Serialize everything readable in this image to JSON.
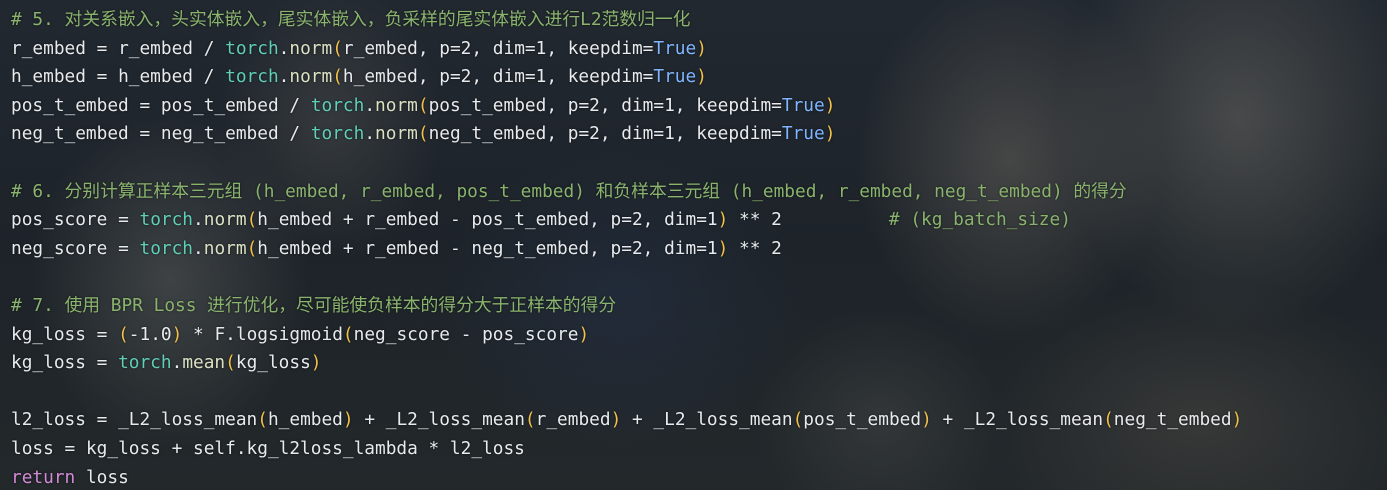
{
  "editor": {
    "language": "python",
    "theme_colors": {
      "comment": "#8ab46e",
      "module": "#5fcfb8",
      "paren": "#f2c14a",
      "keyword": "#d28bd6",
      "constant": "#7fb6ff",
      "text": "#e8ebee"
    },
    "lines": [
      [
        {
          "t": "comment",
          "v": "# 5. 对关系嵌入，头实体嵌入，尾实体嵌入，负采样的尾实体嵌入进行L2范数归一化"
        }
      ],
      [
        {
          "t": "ident",
          "v": "r_embed"
        },
        {
          "t": "op",
          "v": " = "
        },
        {
          "t": "ident",
          "v": "r_embed"
        },
        {
          "t": "op",
          "v": " / "
        },
        {
          "t": "module",
          "v": "torch"
        },
        {
          "t": "op",
          "v": "."
        },
        {
          "t": "func",
          "v": "norm"
        },
        {
          "t": "paren",
          "v": "("
        },
        {
          "t": "ident",
          "v": "r_embed, p=2, dim=1, keepdim="
        },
        {
          "t": "const",
          "v": "True"
        },
        {
          "t": "paren",
          "v": ")"
        }
      ],
      [
        {
          "t": "ident",
          "v": "h_embed"
        },
        {
          "t": "op",
          "v": " = "
        },
        {
          "t": "ident",
          "v": "h_embed"
        },
        {
          "t": "op",
          "v": " / "
        },
        {
          "t": "module",
          "v": "torch"
        },
        {
          "t": "op",
          "v": "."
        },
        {
          "t": "func",
          "v": "norm"
        },
        {
          "t": "paren",
          "v": "("
        },
        {
          "t": "ident",
          "v": "h_embed, p=2, dim=1, keepdim="
        },
        {
          "t": "const",
          "v": "True"
        },
        {
          "t": "paren",
          "v": ")"
        }
      ],
      [
        {
          "t": "ident",
          "v": "pos_t_embed"
        },
        {
          "t": "op",
          "v": " = "
        },
        {
          "t": "ident",
          "v": "pos_t_embed"
        },
        {
          "t": "op",
          "v": " / "
        },
        {
          "t": "module",
          "v": "torch"
        },
        {
          "t": "op",
          "v": "."
        },
        {
          "t": "func",
          "v": "norm"
        },
        {
          "t": "paren",
          "v": "("
        },
        {
          "t": "ident",
          "v": "pos_t_embed, p=2, dim=1, keepdim="
        },
        {
          "t": "const",
          "v": "True"
        },
        {
          "t": "paren",
          "v": ")"
        }
      ],
      [
        {
          "t": "ident",
          "v": "neg_t_embed"
        },
        {
          "t": "op",
          "v": " = "
        },
        {
          "t": "ident",
          "v": "neg_t_embed"
        },
        {
          "t": "op",
          "v": " / "
        },
        {
          "t": "module",
          "v": "torch"
        },
        {
          "t": "op",
          "v": "."
        },
        {
          "t": "func",
          "v": "norm"
        },
        {
          "t": "paren",
          "v": "("
        },
        {
          "t": "ident",
          "v": "neg_t_embed, p=2, dim=1, keepdim="
        },
        {
          "t": "const",
          "v": "True"
        },
        {
          "t": "paren",
          "v": ")"
        }
      ],
      [],
      [
        {
          "t": "comment",
          "v": "# 6. 分别计算正样本三元组 (h_embed, r_embed, pos_t_embed) 和负样本三元组 (h_embed, r_embed, neg_t_embed) 的得分"
        }
      ],
      [
        {
          "t": "ident",
          "v": "pos_score"
        },
        {
          "t": "op",
          "v": " = "
        },
        {
          "t": "module",
          "v": "torch"
        },
        {
          "t": "op",
          "v": "."
        },
        {
          "t": "func",
          "v": "norm"
        },
        {
          "t": "paren",
          "v": "("
        },
        {
          "t": "ident",
          "v": "h_embed + r_embed - pos_t_embed, p=2, dim=1"
        },
        {
          "t": "paren",
          "v": ")"
        },
        {
          "t": "op",
          "v": " ** 2          "
        },
        {
          "t": "comment",
          "v": "# (kg_batch_size)"
        }
      ],
      [
        {
          "t": "ident",
          "v": "neg_score"
        },
        {
          "t": "op",
          "v": " = "
        },
        {
          "t": "module",
          "v": "torch"
        },
        {
          "t": "op",
          "v": "."
        },
        {
          "t": "func",
          "v": "norm"
        },
        {
          "t": "paren",
          "v": "("
        },
        {
          "t": "ident",
          "v": "h_embed + r_embed - neg_t_embed, p=2, dim=1"
        },
        {
          "t": "paren",
          "v": ")"
        },
        {
          "t": "op",
          "v": " ** 2"
        }
      ],
      [],
      [
        {
          "t": "comment",
          "v": "# 7. 使用 BPR Loss 进行优化，尽可能使负样本的得分大于正样本的得分"
        }
      ],
      [
        {
          "t": "ident",
          "v": "kg_loss"
        },
        {
          "t": "op",
          "v": " = "
        },
        {
          "t": "paren",
          "v": "("
        },
        {
          "t": "ident",
          "v": "-1.0"
        },
        {
          "t": "paren",
          "v": ")"
        },
        {
          "t": "op",
          "v": " * "
        },
        {
          "t": "ident",
          "v": "F.logsigmoid"
        },
        {
          "t": "paren",
          "v": "("
        },
        {
          "t": "ident",
          "v": "neg_score - pos_score"
        },
        {
          "t": "paren",
          "v": ")"
        }
      ],
      [
        {
          "t": "ident",
          "v": "kg_loss"
        },
        {
          "t": "op",
          "v": " = "
        },
        {
          "t": "module",
          "v": "torch"
        },
        {
          "t": "op",
          "v": "."
        },
        {
          "t": "func",
          "v": "mean"
        },
        {
          "t": "paren",
          "v": "("
        },
        {
          "t": "ident",
          "v": "kg_loss"
        },
        {
          "t": "paren",
          "v": ")"
        }
      ],
      [],
      [
        {
          "t": "ident",
          "v": "l2_loss"
        },
        {
          "t": "op",
          "v": " = "
        },
        {
          "t": "ident",
          "v": "_L2_loss_mean"
        },
        {
          "t": "paren",
          "v": "("
        },
        {
          "t": "ident",
          "v": "h_embed"
        },
        {
          "t": "paren",
          "v": ")"
        },
        {
          "t": "op",
          "v": " + "
        },
        {
          "t": "ident",
          "v": "_L2_loss_mean"
        },
        {
          "t": "paren",
          "v": "("
        },
        {
          "t": "ident",
          "v": "r_embed"
        },
        {
          "t": "paren",
          "v": ")"
        },
        {
          "t": "op",
          "v": " + "
        },
        {
          "t": "ident",
          "v": "_L2_loss_mean"
        },
        {
          "t": "paren",
          "v": "("
        },
        {
          "t": "ident",
          "v": "pos_t_embed"
        },
        {
          "t": "paren",
          "v": ")"
        },
        {
          "t": "op",
          "v": " + "
        },
        {
          "t": "ident",
          "v": "_L2_loss_mean"
        },
        {
          "t": "paren",
          "v": "("
        },
        {
          "t": "ident",
          "v": "neg_t_embed"
        },
        {
          "t": "paren",
          "v": ")"
        }
      ],
      [
        {
          "t": "ident",
          "v": "loss"
        },
        {
          "t": "op",
          "v": " = "
        },
        {
          "t": "ident",
          "v": "kg_loss + self.kg_l2loss_lambda * l2_loss"
        }
      ],
      [
        {
          "t": "kw",
          "v": "return"
        },
        {
          "t": "op",
          "v": " "
        },
        {
          "t": "ident",
          "v": "loss"
        }
      ]
    ]
  }
}
